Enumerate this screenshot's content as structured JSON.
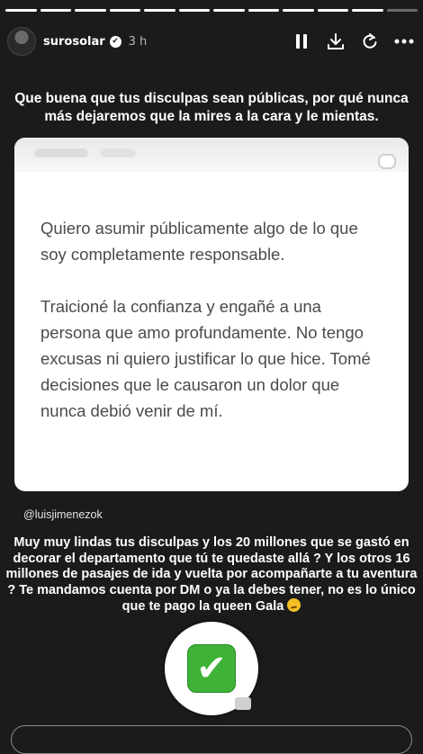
{
  "story": {
    "progress_segments": 12,
    "progress_completed": 11
  },
  "header": {
    "username": "surosolar",
    "verified_mark": "✔",
    "time": "3 h",
    "controls": [
      "pause-icon",
      "download-icon",
      "refresh-icon",
      "more-icon"
    ]
  },
  "caption_top": "Que buena que tus disculpas sean públicas, por qué nunca más dejaremos que la mires a la cara y le mientas.",
  "card": {
    "paragraph_1": "Quiero asumir públicamente algo de lo que soy completamente responsable.",
    "paragraph_2": "Traicioné la confianza y engañé a una persona que amo profundamente. No tengo excusas ni quiero justificar lo que hice. Tomé decisiones que le causaron un dolor que nunca debió venir de mí."
  },
  "handle": "@luisjimenezok",
  "caption_bottom": "Muy muy lindas tus disculpas y los 20 millones que se gastó en decorar el departamento que tú te quedaste allá ? Y los otros 16 millones de pasajes de ida y vuelta por acompañarte a tu aventura ? Te mandamos cuenta por DM o ya la debes tener, no es lo único que te pago la queen Gala",
  "sticker": {
    "glyph": "✔",
    "icon": "check-mark-button-icon",
    "color": "#3fb338"
  },
  "colors": {
    "background": "#1b1b1b",
    "card": "#ffffff",
    "card_text": "#4b4b4b"
  }
}
